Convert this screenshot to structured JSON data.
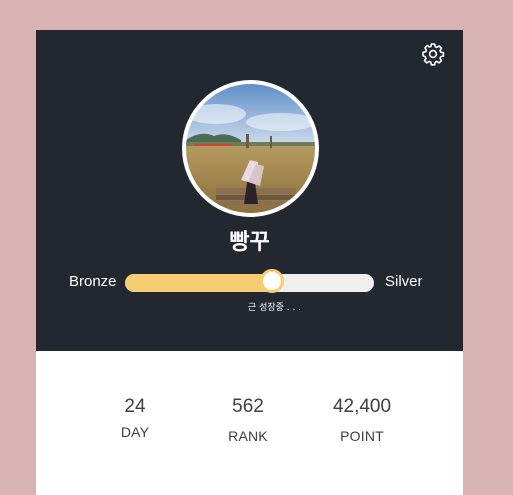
{
  "profile": {
    "username": "빵꾸",
    "avatar_icon": "profile-photo",
    "settings_icon": "gear-icon"
  },
  "tier": {
    "current": "Bronze",
    "next": "Silver",
    "progress": 0.59,
    "status_text": "근 성장중 . . ."
  },
  "stats": [
    {
      "value": "24",
      "label": "DAY"
    },
    {
      "value": "562",
      "label": "RANK"
    },
    {
      "value": "42,400",
      "label": "POINT"
    }
  ],
  "colors": {
    "header_bg": "#23272f",
    "progress_fill": "#f6cd72",
    "progress_track": "#f1eeee",
    "page_bg": "#d8b3b3"
  }
}
